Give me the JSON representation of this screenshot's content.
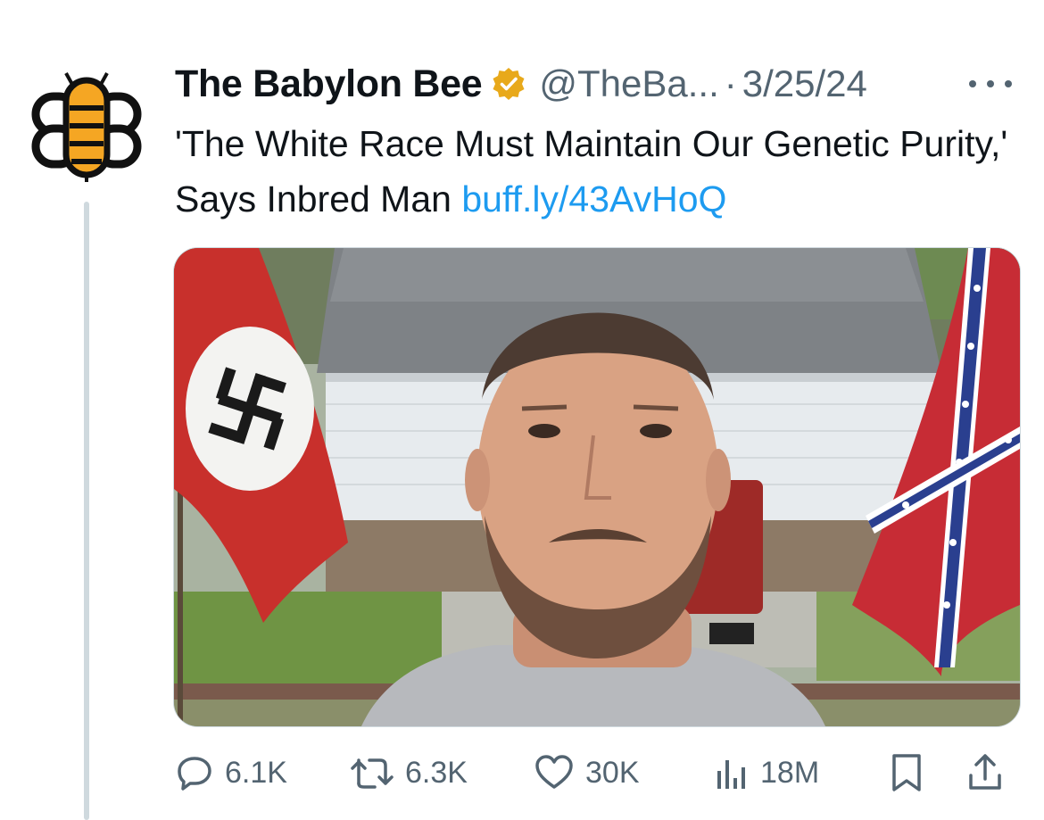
{
  "tweet": {
    "author_name": "The Babylon Bee",
    "verified_icon": "verified-badge-icon",
    "handle": "@TheBa...",
    "separator": "·",
    "date": "3/25/24",
    "text_main": "'The White Race Must Maintain Our Genetic Purity,' Says Inbred Man",
    "link_text": "buff.ly/43AvHoQ",
    "media_description_icon": "photo",
    "colors": {
      "link": "#1d9bf0",
      "muted": "#536471",
      "badge": "#e8a91b"
    }
  },
  "actions": {
    "replies": "6.1K",
    "retweets": "6.3K",
    "likes": "30K",
    "views": "18M",
    "icons": [
      "reply-icon",
      "retweet-icon",
      "like-icon",
      "views-icon",
      "bookmark-icon",
      "share-icon"
    ]
  }
}
